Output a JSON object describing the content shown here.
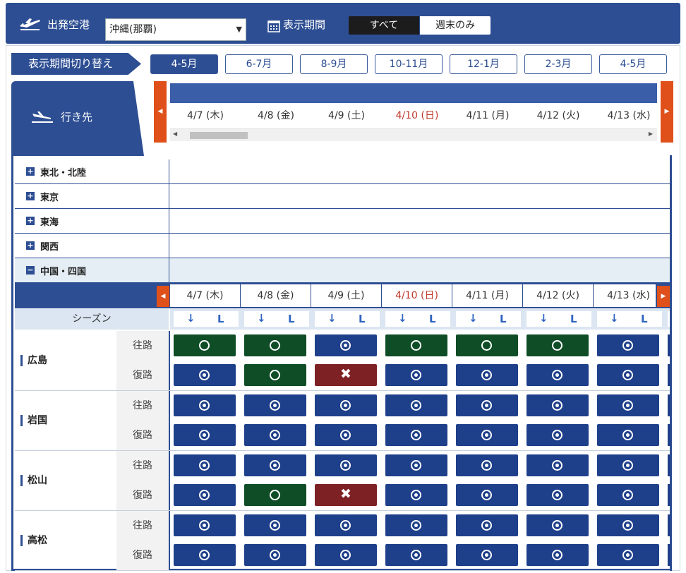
{
  "topbar": {
    "departure_label": "出発空港",
    "departure_value": "沖縄(那覇)",
    "period_label": "表示期間",
    "segment_all": "すべて",
    "segment_weekend": "週末のみ"
  },
  "period_switch": {
    "label": "表示期間切り替え",
    "buttons": [
      "4-5月",
      "6-7月",
      "8-9月",
      "10-11月",
      "12-1月",
      "2-3月",
      "4-5月"
    ],
    "active_index": 0
  },
  "destination_tab": {
    "label": "行き先"
  },
  "dates": [
    "4/7 (木)",
    "4/8 (金)",
    "4/9 (土)",
    "4/10 (日)",
    "4/11 (月)",
    "4/12 (火)",
    "4/13 (水)"
  ],
  "sunday_index": 3,
  "regions": [
    {
      "name": "東北・北陸",
      "toggle": "+"
    },
    {
      "name": "東京",
      "toggle": "+"
    },
    {
      "name": "東海",
      "toggle": "+"
    },
    {
      "name": "関西",
      "toggle": "+"
    },
    {
      "name": "中国・四国",
      "toggle": "−"
    }
  ],
  "season_label": "シーズン",
  "season_cell": {
    "arrow": "↓",
    "letter": "L"
  },
  "cities": [
    {
      "name": "広島",
      "outbound": {
        "label": "往路",
        "cells": [
          "green",
          "green",
          "blue",
          "green",
          "green",
          "green",
          "blue"
        ]
      },
      "return": {
        "label": "復路",
        "cells": [
          "blue",
          "green",
          "red",
          "blue",
          "blue",
          "blue",
          "blue"
        ]
      }
    },
    {
      "name": "岩国",
      "outbound": {
        "label": "往路",
        "cells": [
          "blue",
          "blue",
          "blue",
          "blue",
          "blue",
          "blue",
          "blue"
        ]
      },
      "return": {
        "label": "復路",
        "cells": [
          "blue",
          "blue",
          "blue",
          "blue",
          "blue",
          "blue",
          "blue"
        ]
      }
    },
    {
      "name": "松山",
      "outbound": {
        "label": "往路",
        "cells": [
          "blue",
          "blue",
          "blue",
          "blue",
          "blue",
          "blue",
          "blue"
        ]
      },
      "return": {
        "label": "復路",
        "cells": [
          "blue",
          "green",
          "red",
          "blue",
          "blue",
          "blue",
          "blue"
        ]
      }
    },
    {
      "name": "高松",
      "outbound": {
        "label": "往路",
        "cells": [
          "blue",
          "blue",
          "blue",
          "blue",
          "blue",
          "blue",
          "blue"
        ]
      },
      "return": {
        "label": "復路",
        "cells": [
          "blue",
          "blue",
          "blue",
          "blue",
          "blue",
          "blue",
          "blue"
        ]
      }
    }
  ],
  "colors": {
    "navy": "#2d4e93",
    "available_blue": "#1e3f8a",
    "available_green": "#0f4d26",
    "unavailable_red": "#7e2124",
    "accent_orange": "#e0501a",
    "sunday_red": "#c0392b"
  },
  "icons": {
    "departure": "airplane-takeoff-icon",
    "calendar": "calendar-icon",
    "destination": "airplane-landing-icon",
    "available_ring": "circle-icon",
    "available_dot": "dot-circle-icon",
    "unavailable": "cross-icon"
  }
}
